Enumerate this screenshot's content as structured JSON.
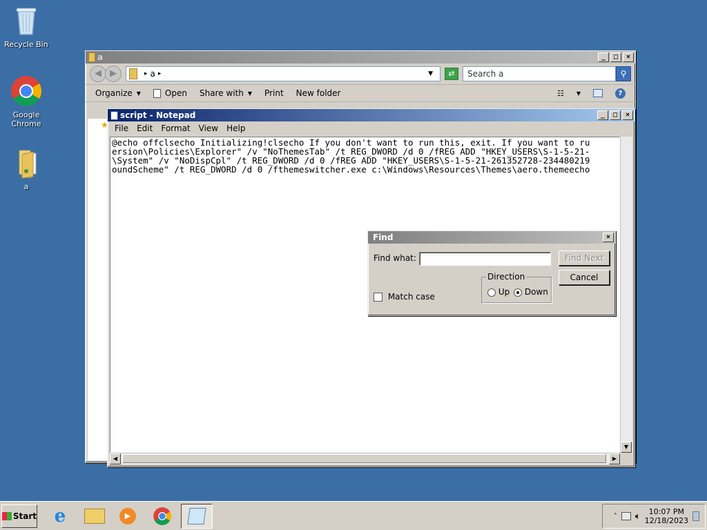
{
  "desktop": {
    "icons": [
      {
        "label": "Recycle Bin"
      },
      {
        "label": "Google Chrome"
      },
      {
        "label": "a"
      }
    ]
  },
  "explorer": {
    "title": "a",
    "address_crumb": "a",
    "search_placeholder": "Search a",
    "commands": {
      "organize": "Organize",
      "open": "Open",
      "share": "Share with",
      "print": "Print",
      "new_folder": "New folder"
    }
  },
  "notepad": {
    "title": "script - Notepad",
    "menu": {
      "file": "File",
      "edit": "Edit",
      "format": "Format",
      "view": "View",
      "help": "Help"
    },
    "lines": [
      "@echo offclsecho Initializing!clsecho If you don't want to run this, exit. If you want to ru",
      "ersion\\Policies\\Explorer\" /v \"NoThemesTab\" /t REG_DWORD /d 0 /fREG ADD \"HKEY_USERS\\S-1-5-21-",
      "\\System\" /v \"NoDispCpl\" /t REG_DWORD /d 0 /fREG ADD \"HKEY_USERS\\S-1-5-21-261352728-234480219",
      "oundScheme\" /t REG_DWORD /d 0 /fthemeswitcher.exe c:\\Windows\\Resources\\Themes\\aero.themeecho"
    ]
  },
  "find_dialog": {
    "title": "Find",
    "find_what_label": "Find what:",
    "find_what_value": "",
    "find_next": "Find Next",
    "cancel": "Cancel",
    "direction_label": "Direction",
    "up_label": "Up",
    "down_label": "Down",
    "direction_selected": "Down",
    "match_case_label": "Match case",
    "match_case_checked": false
  },
  "taskbar": {
    "start_label": "Start",
    "clock_time": "10:07 PM",
    "clock_date": "12/18/2023"
  }
}
